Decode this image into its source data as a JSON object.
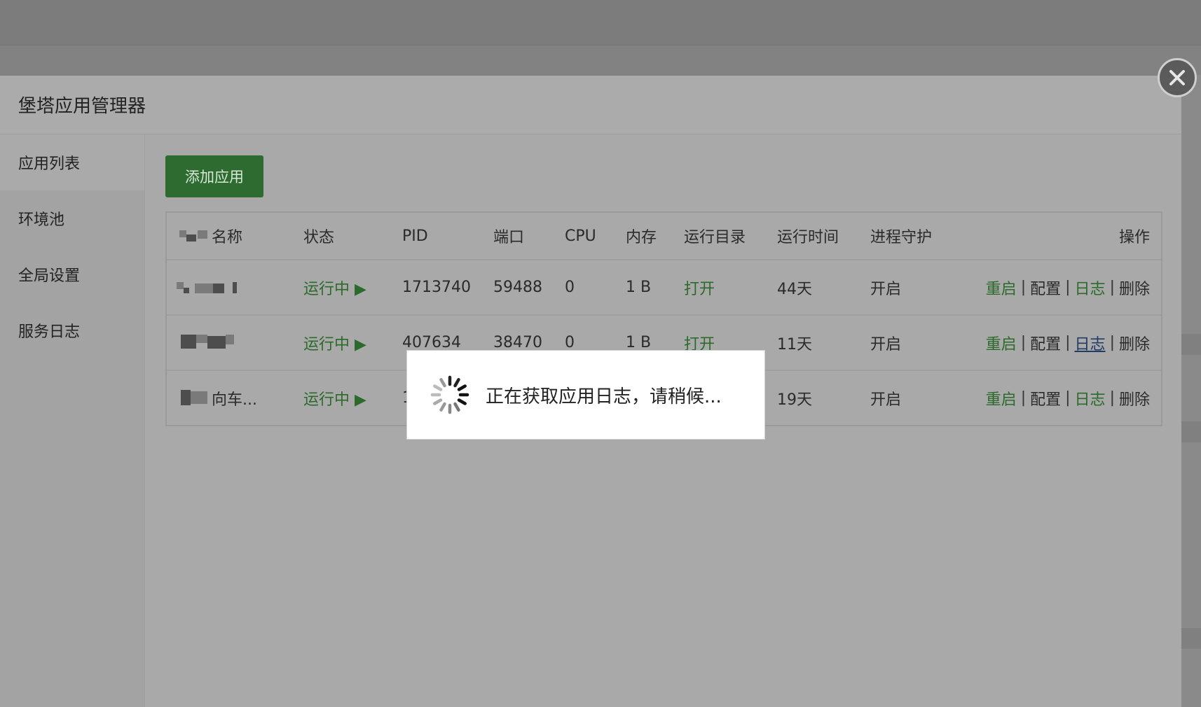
{
  "dialog": {
    "title": "堡塔应用管理器"
  },
  "sidebar": {
    "items": [
      {
        "label": "应用列表"
      },
      {
        "label": "环境池"
      },
      {
        "label": "全局设置"
      },
      {
        "label": "服务日志"
      }
    ]
  },
  "toolbar": {
    "add_label": "添加应用"
  },
  "table": {
    "headers": {
      "name": "名称",
      "status": "状态",
      "pid": "PID",
      "port": "端口",
      "cpu": "CPU",
      "memory": "内存",
      "run_dir": "运行目录",
      "run_time": "运行时间",
      "guard": "进程守护",
      "ops": "操作"
    },
    "rows": [
      {
        "name": "",
        "status": "运行中 ▶",
        "pid": "1713740",
        "port": "59488",
        "cpu": "0",
        "memory": "1 B",
        "run_dir": "打开",
        "run_time": "44天",
        "guard": "开启"
      },
      {
        "name": "",
        "status": "运行中 ▶",
        "pid": "407634",
        "port": "38470",
        "cpu": "0",
        "memory": "1 B",
        "run_dir": "打开",
        "run_time": "11天",
        "guard": "开启"
      },
      {
        "name": "向车...",
        "status": "运行中 ▶",
        "pid": "1",
        "port": "",
        "cpu": "",
        "memory": "",
        "run_dir": "",
        "run_time": "19天",
        "guard": "开启"
      }
    ],
    "actions": {
      "restart": "重启",
      "config": "配置",
      "log": "日志",
      "delete": "删除",
      "separator": "|"
    }
  },
  "loading": {
    "message": "正在获取应用日志，请稍候..."
  },
  "colors": {
    "accent_green": "#2e6b30",
    "link_green": "#2b6a2b",
    "overlay": "#7f7f7f"
  }
}
